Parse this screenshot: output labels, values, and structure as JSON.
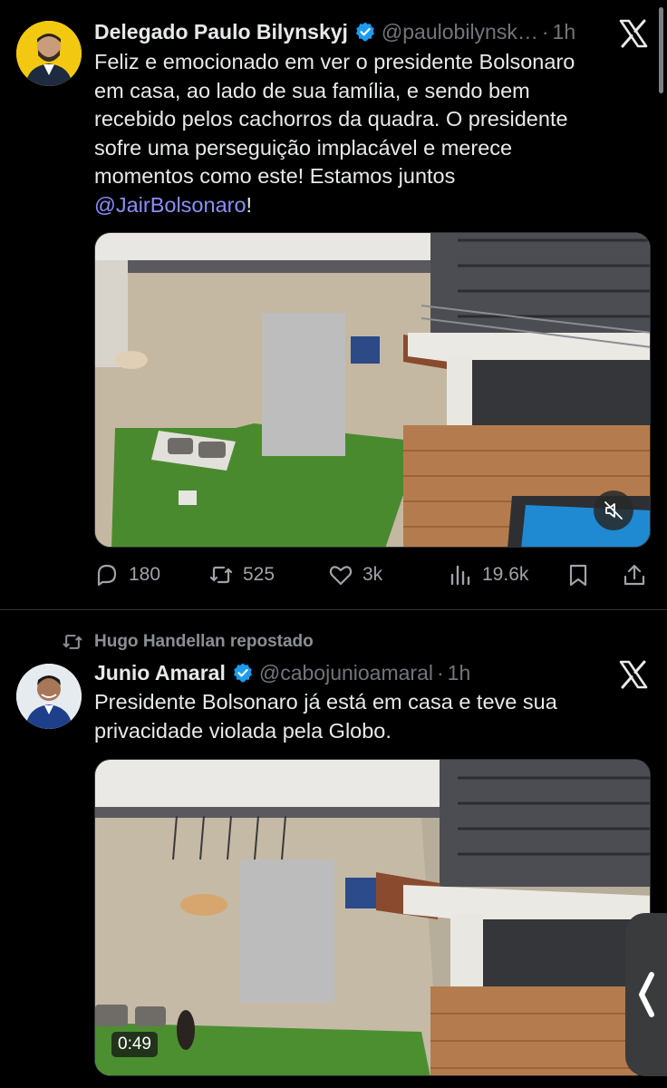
{
  "tweets": [
    {
      "display_name": "Delegado Paulo Bilynskyj",
      "handle": "@paulobilynsk…",
      "separator": "·",
      "time": "1h",
      "text_lines": [
        "Feliz e emocionado em ver o presidente Bolsonaro",
        "em casa, ao lado de sua família, e sendo bem",
        "recebido pelos cachorros da quadra. O presidente",
        "sofre uma perseguição implacável e merece",
        "momentos como este! Estamos juntos"
      ],
      "mention": "@JairBolsonaro",
      "mention_suffix": "!",
      "actions": {
        "replies": "180",
        "reposts": "525",
        "likes": "3k",
        "views": "19.6k"
      }
    },
    {
      "repost_label": "Hugo Handellan repostado",
      "display_name": "Junio Amaral",
      "handle": "@cabojunioamaral",
      "separator": "·",
      "time": "1h",
      "text_lines": [
        "Presidente Bolsonaro já está em casa e teve sua",
        "privacidade violada pela Globo."
      ],
      "video_duration": "0:49"
    }
  ],
  "icons": {
    "verified": "verified-badge-icon",
    "x_logo": "x-logo-icon",
    "reply": "reply-icon",
    "repost": "repost-icon",
    "like": "heart-icon",
    "views": "views-icon",
    "bookmark": "bookmark-icon",
    "share": "share-icon",
    "mute": "muted-speaker-icon",
    "handle": "chevron-left-icon"
  },
  "colors": {
    "background": "#000000",
    "text": "#e7e9ea",
    "secondary": "#71767b",
    "mention": "#8b8ff5",
    "verified": "#1d9bf0"
  }
}
